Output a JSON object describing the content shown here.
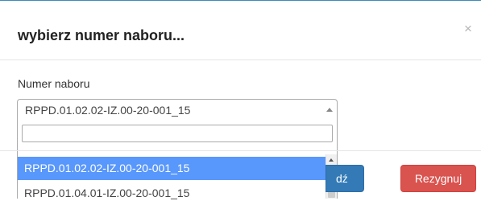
{
  "modal": {
    "title": "wybierz numer naboru...",
    "close_glyph": "×"
  },
  "form": {
    "label": "Numer naboru",
    "selected_value": "RPPD.01.02.02-IZ.00-20-001_15",
    "search_value": "",
    "options": [
      {
        "label": "RPPD.01.02.02-IZ.00-20-001_15",
        "highlighted": true
      },
      {
        "label": "RPPD.01.04.01-IZ.00-20-001_15",
        "highlighted": false
      }
    ]
  },
  "footer": {
    "confirm_label": "dź",
    "cancel_label": "Rezygnuj"
  },
  "colors": {
    "accent": "#3c8dbc",
    "highlight": "#5897fb",
    "primary": "#337ab7",
    "danger": "#d9534f"
  },
  "icons": {
    "close": "close-icon",
    "select_arrow": "caret-up-icon",
    "scroll_up": "scroll-up-arrow-icon"
  }
}
